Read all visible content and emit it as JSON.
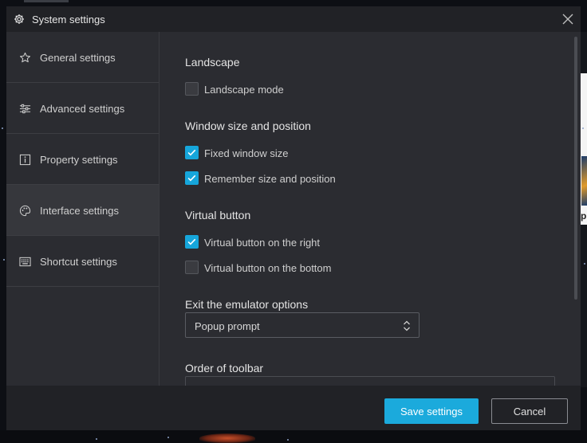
{
  "window": {
    "title": "System settings"
  },
  "sidebar": {
    "items": [
      {
        "label": "General settings",
        "icon": "star-icon",
        "active": false
      },
      {
        "label": "Advanced settings",
        "icon": "sliders-icon",
        "active": false
      },
      {
        "label": "Property settings",
        "icon": "info-icon",
        "active": false
      },
      {
        "label": "Interface settings",
        "icon": "palette-icon",
        "active": true
      },
      {
        "label": "Shortcut settings",
        "icon": "keyboard-icon",
        "active": false
      }
    ]
  },
  "content": {
    "landscape": {
      "title": "Landscape",
      "options": [
        {
          "label": "Landscape mode",
          "checked": false
        }
      ]
    },
    "window_size": {
      "title": "Window size and position",
      "options": [
        {
          "label": "Fixed window size",
          "checked": true
        },
        {
          "label": "Remember size and position",
          "checked": true
        }
      ]
    },
    "virtual_button": {
      "title": "Virtual button",
      "options": [
        {
          "label": "Virtual button on the right",
          "checked": true
        },
        {
          "label": "Virtual button on the bottom",
          "checked": false
        }
      ]
    },
    "exit_options": {
      "title": "Exit the emulator options",
      "selected": "Popup prompt"
    },
    "toolbar_order": {
      "title": "Order of toolbar"
    }
  },
  "footer": {
    "save_label": "Save settings",
    "cancel_label": "Cancel"
  },
  "colors": {
    "accent": "#1baadc",
    "dialog_bg": "#2b2c31",
    "titlebar_bg": "#212226"
  }
}
